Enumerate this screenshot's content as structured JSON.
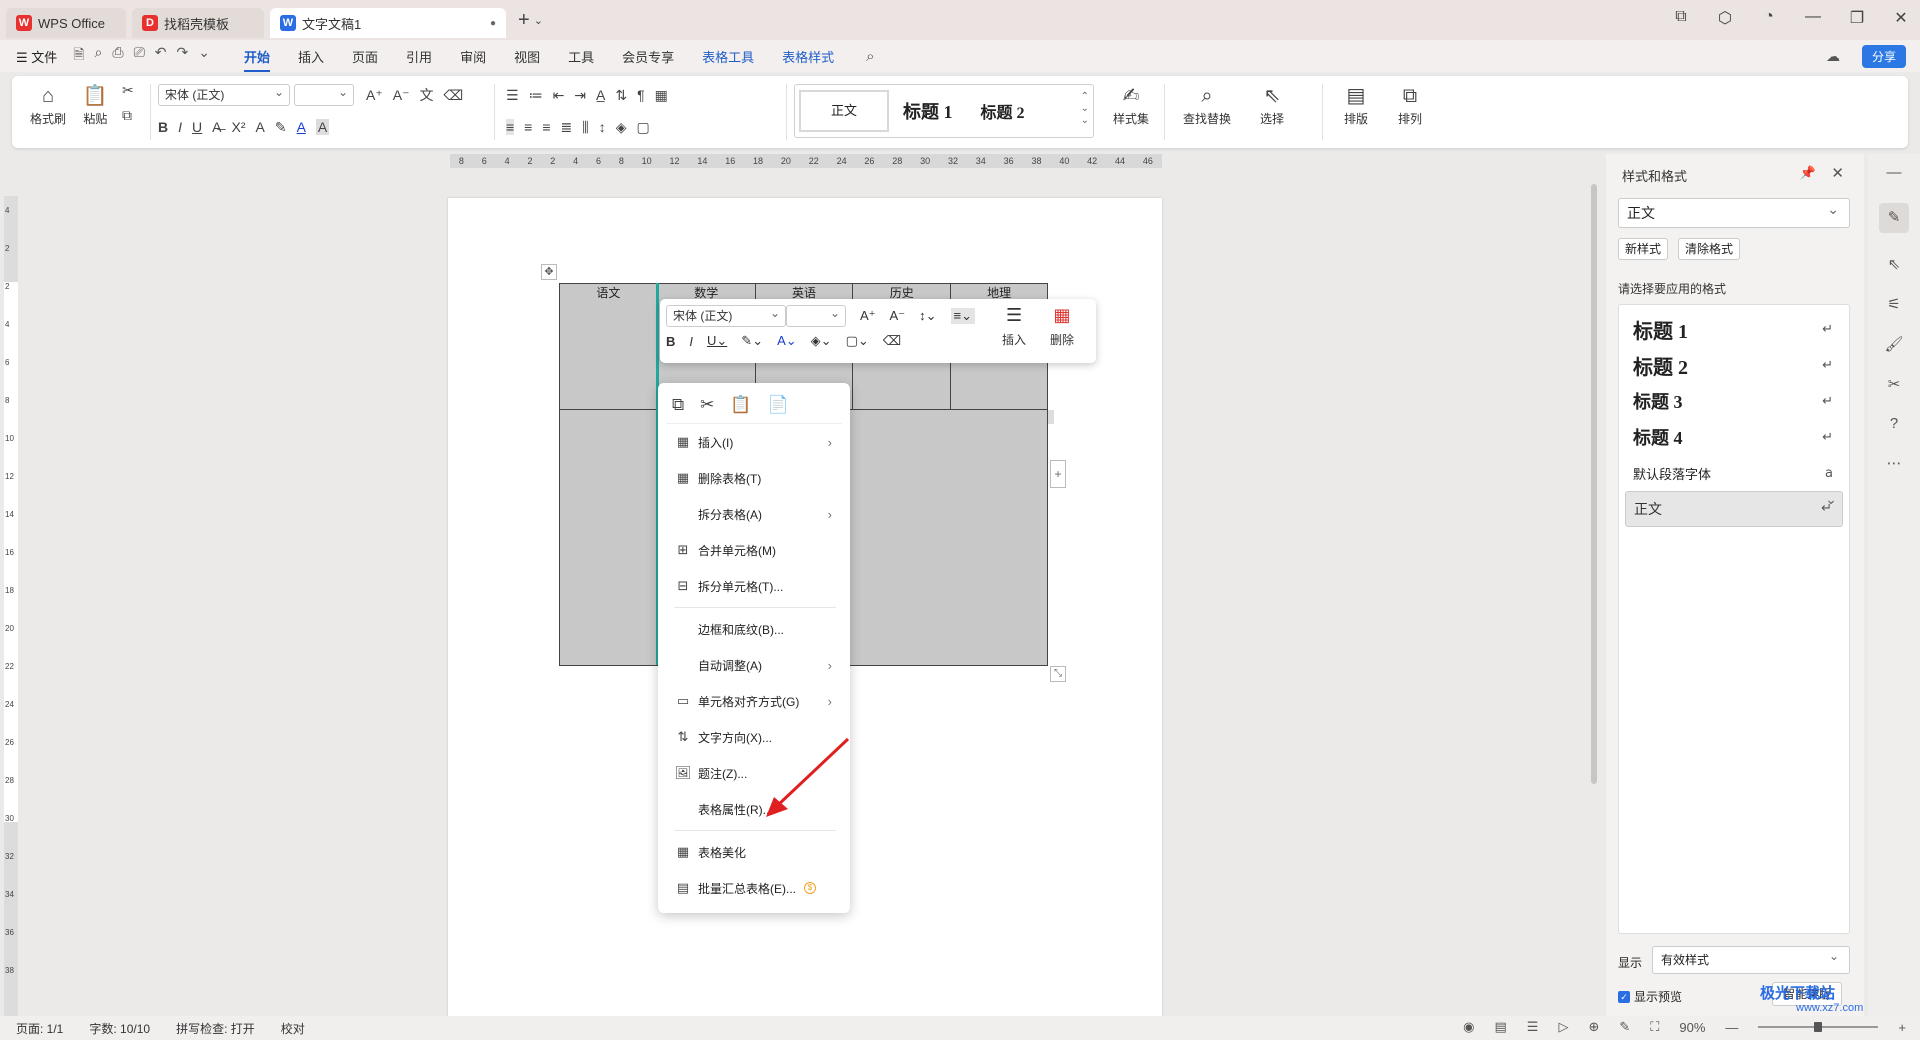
{
  "titlebar": {
    "tabs": [
      {
        "label": "WPS Office",
        "logo": "W"
      },
      {
        "label": "找稻壳模板",
        "logo": "D"
      },
      {
        "label": "文字文稿1",
        "logo": "W",
        "modified": "●"
      }
    ],
    "add_tab": "+",
    "add_tab_arrow": "⌄"
  },
  "menubar": {
    "file": "☰ 文件",
    "items": [
      "开始",
      "插入",
      "页面",
      "引用",
      "审阅",
      "视图",
      "工具",
      "会员专享"
    ],
    "context_items": [
      "表格工具",
      "表格样式"
    ],
    "share": "分享"
  },
  "ribbon": {
    "format_painter": "格式刷",
    "paste": "粘贴",
    "font_name": "宋体 (正文)",
    "font_size": "",
    "styles": [
      "正文",
      "标题 1",
      "标题 2"
    ],
    "style_set": "样式集",
    "find_replace": "查找替换",
    "select": "选择",
    "layout": "排版",
    "arrange": "排列"
  },
  "ruler": {
    "h_ticks": [
      "8",
      "6",
      "4",
      "2",
      "2",
      "4",
      "6",
      "8",
      "10",
      "12",
      "14",
      "16",
      "18",
      "20",
      "22",
      "24",
      "26",
      "28",
      "30",
      "32",
      "34",
      "36",
      "38",
      "40",
      "42",
      "44",
      "46"
    ],
    "v_ticks": [
      "4",
      "2",
      "2",
      "4",
      "6",
      "8",
      "10",
      "12",
      "14",
      "16",
      "18",
      "20",
      "22",
      "24",
      "26",
      "28",
      "30",
      "32",
      "34",
      "36",
      "38"
    ]
  },
  "table": {
    "headers": [
      "语文",
      "数学",
      "英语",
      "历史",
      "地理"
    ]
  },
  "mini_toolbar": {
    "font_name": "宋体 (正文)",
    "insert": "插入",
    "delete": "删除"
  },
  "context_menu": {
    "items": [
      {
        "label": "插入(I)",
        "submenu": true
      },
      {
        "label": "删除表格(T)"
      },
      {
        "label": "拆分表格(A)",
        "submenu": true
      },
      {
        "label": "合并单元格(M)"
      },
      {
        "label": "拆分单元格(T)..."
      },
      {
        "label": "边框和底纹(B)..."
      },
      {
        "label": "自动调整(A)",
        "submenu": true
      },
      {
        "label": "单元格对齐方式(G)",
        "submenu": true
      },
      {
        "label": "文字方向(X)..."
      },
      {
        "label": "题注(Z)..."
      },
      {
        "label": "表格属性(R)..."
      },
      {
        "label": "表格美化"
      },
      {
        "label": "批量汇总表格(E)..."
      }
    ],
    "submenu_arrow": "›"
  },
  "sidepane": {
    "title": "样式和格式",
    "current_style": "正文",
    "new_style": "新样式",
    "clear_format": "清除格式",
    "prompt": "请选择要应用的格式",
    "styles": [
      "标题 1",
      "标题 2",
      "标题 3",
      "标题 4",
      "默认段落字体",
      "正文"
    ],
    "return_glyph": "↵",
    "show_label": "显示",
    "show_value": "有效样式",
    "preview_label": "显示预览",
    "smart_layout": "智能排版"
  },
  "statusbar": {
    "page": "页面: 1/1",
    "words": "字数: 10/10",
    "spell": "拼写检查: 打开",
    "proof": "校对",
    "zoom": "90%"
  },
  "watermark": {
    "title": "极光下载站",
    "url": "www.xz7.com"
  },
  "colors": {
    "accent": "#1f5ec8",
    "table_fill": "#c8c8c8",
    "selection_line": "#24a79d",
    "annotation_arrow": "#e02020"
  }
}
